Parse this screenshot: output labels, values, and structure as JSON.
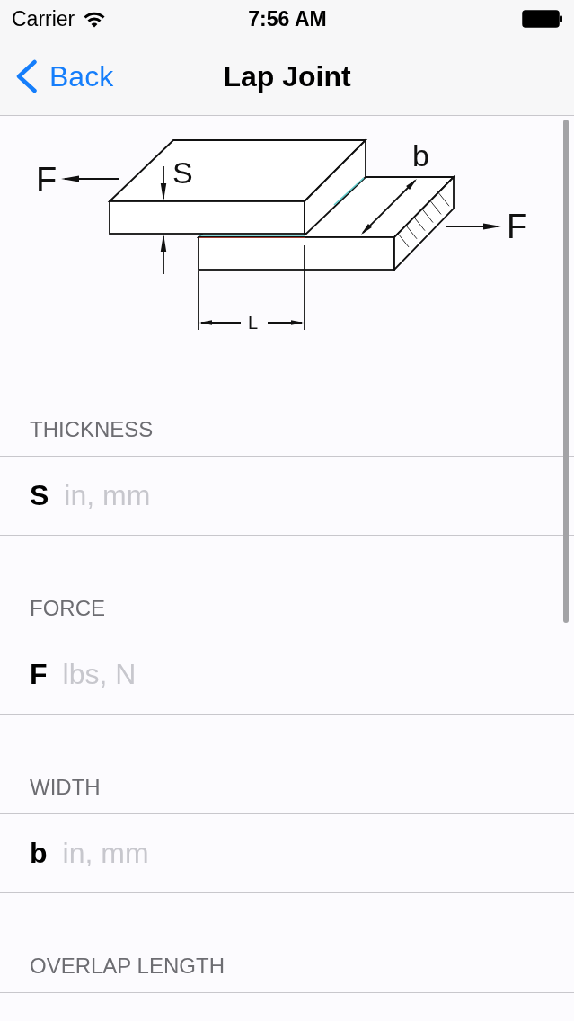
{
  "status_bar": {
    "carrier": "Carrier",
    "time": "7:56 AM"
  },
  "nav_bar": {
    "back": "Back",
    "title": "Lap Joint"
  },
  "diagram": {
    "force_left": "F",
    "thickness": "S",
    "width": "b",
    "force_right": "F",
    "length": "L"
  },
  "sections": [
    {
      "header": "THICKNESS",
      "symbol": "S",
      "placeholder": "in, mm"
    },
    {
      "header": "FORCE",
      "symbol": "F",
      "placeholder": "lbs, N"
    },
    {
      "header": "WIDTH",
      "symbol": "b",
      "placeholder": "in, mm"
    },
    {
      "header": "OVERLAP LENGTH"
    }
  ]
}
